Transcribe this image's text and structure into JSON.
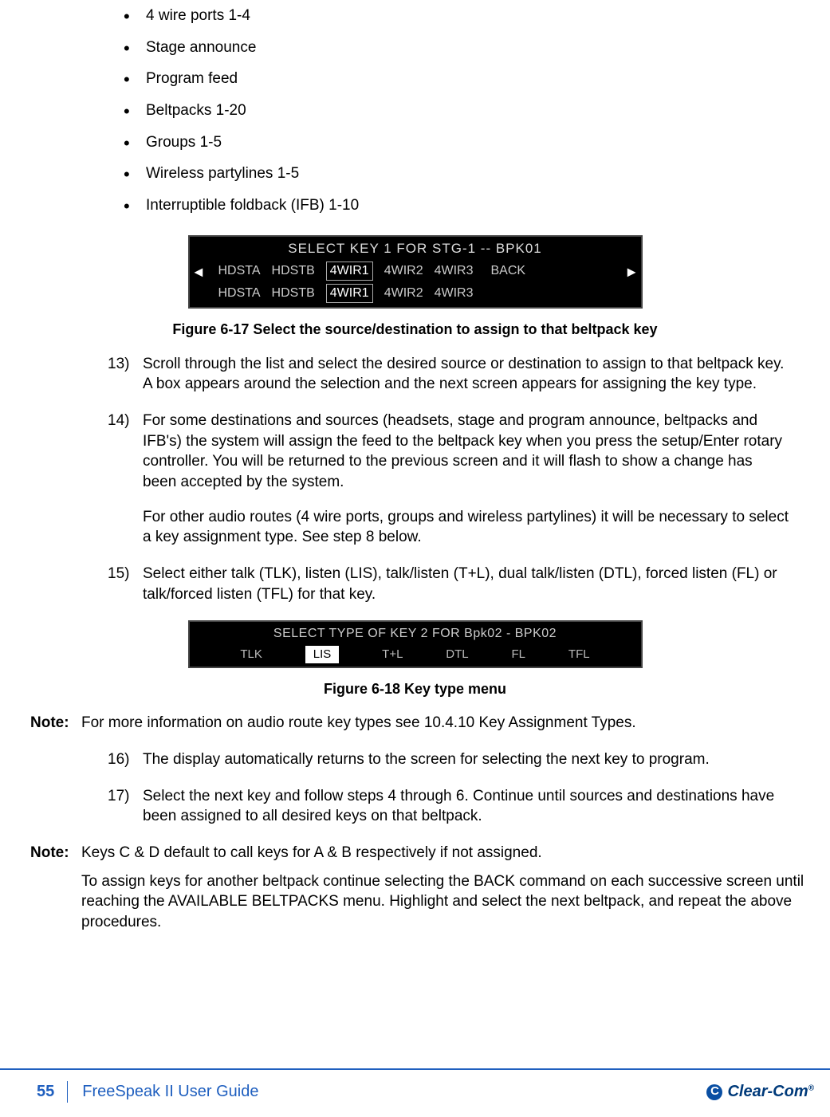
{
  "bullets": [
    "4 wire ports 1-4",
    "Stage announce",
    "Program feed",
    "Beltpacks 1-20",
    "Groups 1-5",
    "Wireless partylines 1-5",
    "Interruptible foldback (IFB) 1-10"
  ],
  "screenshot1": {
    "header": "SELECT KEY 1 FOR STG-1 -- BPK01",
    "row1": [
      "HDSTA",
      "HDSTB",
      "4WIR1",
      "4WIR2",
      "4WIR3",
      "BACK"
    ],
    "row2": [
      "HDSTA",
      "HDSTB",
      "4WIR1",
      "4WIR2",
      "4WIR3"
    ],
    "selected": "4WIR1"
  },
  "caption1": "Figure 6-17 Select the source/destination to assign to that beltpack key",
  "steps_a": [
    {
      "num": "13)",
      "paras": [
        "Scroll through the list and select the desired source or destination to assign to that beltpack key. A box appears around the selection and the next screen appears for assigning the key type."
      ]
    },
    {
      "num": "14)",
      "paras": [
        "For some destinations and sources (headsets, stage and program announce, beltpacks and IFB's) the system will assign the feed to the beltpack key when you press the setup/Enter rotary controller. You will be returned to the previous screen and it will flash to show a change has been accepted by the system.",
        "For other audio routes (4 wire ports, groups and wireless partylines) it will be necessary to select a key assignment type. See step 8 below."
      ]
    },
    {
      "num": "15)",
      "paras": [
        "Select either talk (TLK), listen (LIS), talk/listen (T+L), dual talk/listen (DTL), forced listen (FL) or talk/forced listen (TFL) for that key."
      ]
    }
  ],
  "screenshot2": {
    "header": "SELECT TYPE OF KEY 2 FOR Bpk02 - BPK02",
    "items": [
      "TLK",
      "LIS",
      "T+L",
      "DTL",
      "FL",
      "TFL"
    ],
    "selected": "LIS"
  },
  "caption2": "Figure 6-18 Key type menu",
  "note1_label": "Note:",
  "note1_text": "For more information on audio route key types see 10.4.10 Key Assignment Types.",
  "steps_b": [
    {
      "num": "16)",
      "paras": [
        "The display automatically returns to the screen for selecting the next key to program."
      ]
    },
    {
      "num": "17)",
      "paras": [
        "Select the next key and follow steps 4 through 6. Continue until sources and destinations have been assigned to all desired keys on that beltpack."
      ]
    }
  ],
  "note2_label": "Note:",
  "note2_paras": [
    "Keys C & D default to call keys for A & B respectively if not assigned.",
    "To assign keys for another beltpack continue selecting the BACK command on each successive screen until reaching the AVAILABLE BELTPACKS menu. Highlight and select the next beltpack, and repeat the above procedures."
  ],
  "footer": {
    "page": "55",
    "title": "FreeSpeak II User Guide",
    "logo": "Clear-Com",
    "logo_glyph": "C"
  }
}
